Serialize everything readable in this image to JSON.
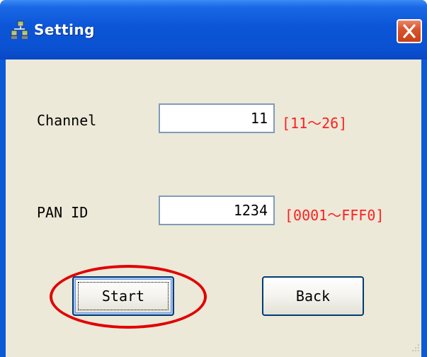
{
  "window": {
    "title": "Setting",
    "title_icon": "network-nodes-icon",
    "close_icon": "close-icon"
  },
  "form": {
    "channel": {
      "label": "Channel",
      "value": "11",
      "range": "[11～26]"
    },
    "pan_id": {
      "label": "PAN ID",
      "value": "1234",
      "range": "[0001～FFF0]"
    }
  },
  "buttons": {
    "start_label": "Start",
    "back_label": "Back",
    "focused": "Start"
  },
  "annotation": {
    "highlight_color": "#e00000",
    "highlight_target": "Start"
  },
  "colors": {
    "title_bar": "#0a52d2",
    "client_bg": "#ece9d8",
    "range_text": "#ff2020",
    "close_button": "#d9542d"
  }
}
